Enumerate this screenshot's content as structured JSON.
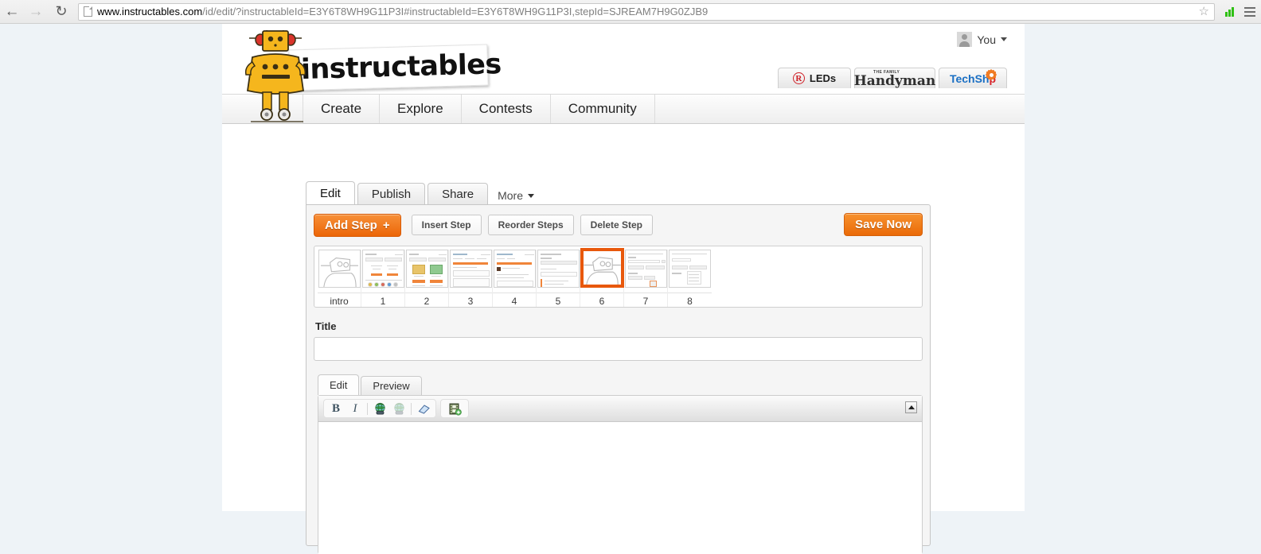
{
  "browser": {
    "back_icon": "back-arrow-icon",
    "forward_icon": "forward-arrow-icon",
    "reload_icon": "reload-icon",
    "url_domain": "www.instructables.com",
    "url_path": "/id/edit/?instructableId=E3Y6T8WH9G11P3I#instructableId=E3Y6T8WH9G11P3I,stepId=SJREAM7H9G0ZJB9",
    "url_full": "www.instructables.com/id/edit/?instructableId=E3Y6T8WH9G11P3I#instructableId=E3Y6T8WH9G11P3I,stepId=SJREAM7H9G0ZJB9",
    "star_glyph": "☆",
    "bookmark_icon": "star-icon",
    "extension_icon": "signal-bars-icon",
    "menu_icon": "hamburger-menu-icon"
  },
  "site": {
    "logo_text": "instructables",
    "logo_icon": "robot-mascot-icon",
    "user": {
      "label": "You",
      "avatar_icon": "avatar-icon",
      "caret_icon": "chevron-down-icon"
    },
    "sponsors": [
      {
        "name": "LEDs",
        "mark": "R",
        "icon": "rapid-leds-logo"
      },
      {
        "name": "Handyman",
        "kicker": "THE FAMILY",
        "icon": "family-handyman-logo"
      },
      {
        "name_part1": "TechSh",
        "name_part2": "p",
        "icon": "techshop-logo"
      }
    ],
    "nav": [
      {
        "label": "Create"
      },
      {
        "label": "Explore"
      },
      {
        "label": "Contests"
      },
      {
        "label": "Community"
      }
    ]
  },
  "editor": {
    "tabs": [
      {
        "label": "Edit",
        "active": true
      },
      {
        "label": "Publish",
        "active": false
      },
      {
        "label": "Share",
        "active": false
      }
    ],
    "more_label": "More",
    "more_caret_icon": "chevron-down-icon",
    "toolbar": {
      "add_step": "Add Step",
      "add_step_glyph": "+",
      "insert_step": "Insert Step",
      "reorder_steps": "Reorder Steps",
      "delete_step": "Delete Step",
      "save_now": "Save Now"
    },
    "steps": [
      {
        "label": "intro",
        "kind": "robot",
        "selected": false
      },
      {
        "label": "1",
        "kind": "doc-a",
        "selected": false
      },
      {
        "label": "2",
        "kind": "doc-b",
        "selected": false
      },
      {
        "label": "3",
        "kind": "doc-c",
        "selected": false
      },
      {
        "label": "4",
        "kind": "doc-d",
        "selected": false
      },
      {
        "label": "5",
        "kind": "doc-e",
        "selected": false
      },
      {
        "label": "6",
        "kind": "robot",
        "selected": true
      },
      {
        "label": "7",
        "kind": "doc-f",
        "selected": false
      },
      {
        "label": "8",
        "kind": "doc-g",
        "selected": false
      }
    ],
    "title_label": "Title",
    "title_value": "",
    "title_placeholder": "",
    "inner_tabs": [
      {
        "label": "Edit",
        "active": true
      },
      {
        "label": "Preview",
        "active": false
      }
    ],
    "rte_toolbar": [
      {
        "icon": "bold-icon",
        "glyph": "B"
      },
      {
        "icon": "italic-icon",
        "glyph": "I"
      },
      {
        "icon": "insert-link-icon",
        "glyph": ""
      },
      {
        "icon": "remove-link-icon",
        "glyph": ""
      },
      {
        "icon": "remove-formatting-eraser-icon",
        "glyph": ""
      }
    ],
    "rte_media_button": {
      "icon": "insert-media-icon"
    },
    "rte_scroll_up": {
      "icon": "scroll-up-arrow-icon"
    },
    "rte_body_text": ""
  },
  "colors": {
    "accent_orange": "#ec6608",
    "selected_step_border": "#e8580c",
    "page_bg": "#ffffff",
    "chrome_bg": "#eef3f7"
  }
}
